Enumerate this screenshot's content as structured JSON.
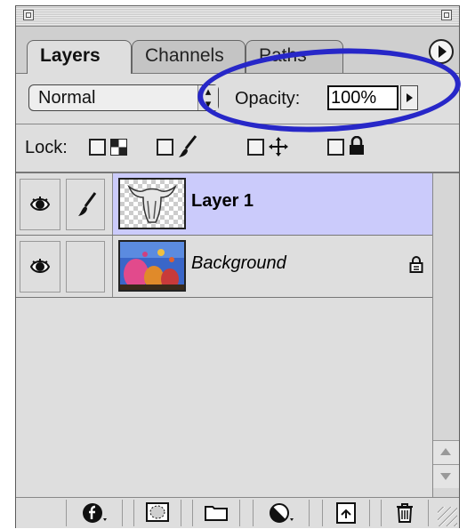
{
  "panel": {
    "tabs": [
      {
        "label": "Layers",
        "active": true
      },
      {
        "label": "Channels",
        "active": false
      },
      {
        "label": "Paths",
        "active": false
      }
    ],
    "menu_icon": "circle-arrow-menu-icon"
  },
  "blend_mode": {
    "value": "Normal",
    "icon": "up-down-arrows-icon"
  },
  "opacity": {
    "label": "Opacity:",
    "value": "100%",
    "icon": "triangle-right-icon"
  },
  "highlight_color": "#2727c8",
  "lock": {
    "label": "Lock:",
    "options": [
      {
        "name": "transparency",
        "icon": "checkerboard-icon"
      },
      {
        "name": "image",
        "icon": "brush-icon"
      },
      {
        "name": "position",
        "icon": "move-cross-icon"
      },
      {
        "name": "all",
        "icon": "padlock-icon"
      }
    ]
  },
  "layers": [
    {
      "name": "Layer 1",
      "visible": true,
      "selected": true,
      "brush_link": true,
      "locked": false,
      "thumb": "skull-on-transparent"
    },
    {
      "name": "Background",
      "visible": true,
      "selected": false,
      "brush_link": false,
      "locked": true,
      "thumb": "hot-air-balloons"
    }
  ],
  "selection_color": "#cbcbfb",
  "bottom_toolbar": [
    {
      "name": "layer-style",
      "icon": "f-circle-icon"
    },
    {
      "name": "add-mask",
      "icon": "mask-icon"
    },
    {
      "name": "new-set",
      "icon": "folder-icon"
    },
    {
      "name": "adjustment-layer",
      "icon": "half-circle-icon"
    },
    {
      "name": "new-layer",
      "icon": "new-page-icon"
    },
    {
      "name": "delete-layer",
      "icon": "trash-icon"
    }
  ]
}
